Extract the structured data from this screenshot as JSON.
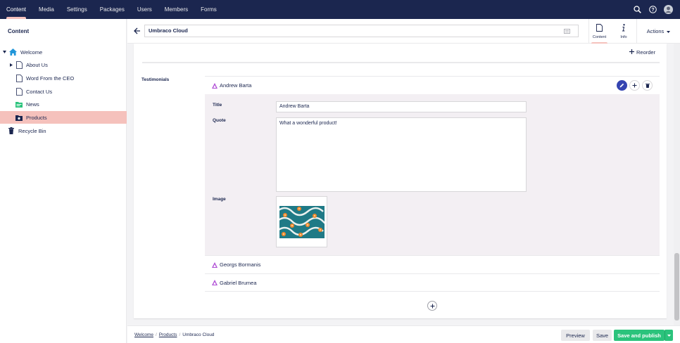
{
  "topnav": {
    "items": [
      "Content",
      "Media",
      "Settings",
      "Packages",
      "Users",
      "Members",
      "Forms"
    ],
    "active_index": 0
  },
  "sidebar": {
    "title": "Content",
    "tree": [
      {
        "label": "Welcome",
        "icon": "home-icon",
        "level": 0,
        "expanded": true
      },
      {
        "label": "About Us",
        "icon": "document-icon",
        "level": 1,
        "expandable": true
      },
      {
        "label": "Word From the CEO",
        "icon": "document-icon",
        "level": 1
      },
      {
        "label": "Contact Us",
        "icon": "document-icon",
        "level": 1
      },
      {
        "label": "News",
        "icon": "news-folder-icon",
        "level": 1
      },
      {
        "label": "Products",
        "icon": "products-folder-icon",
        "level": 1,
        "selected": true
      },
      {
        "label": "Recycle Bin",
        "icon": "trash-icon",
        "level": 0
      }
    ]
  },
  "editor": {
    "node_name": "Umbraco Cloud",
    "apps": [
      {
        "label": "Content",
        "icon": "document-icon",
        "active": true
      },
      {
        "label": "Info",
        "icon": "info-icon",
        "active": false
      }
    ],
    "actions_label": "Actions",
    "reorder_label": "Reorder",
    "property_label": "Testimonials",
    "blocks": [
      {
        "name": "Andrew Barta",
        "expanded": true,
        "fields": {
          "title_label": "Title",
          "title_value": "Andrew Barta",
          "quote_label": "Quote",
          "quote_value": "What a wonderful product!",
          "image_label": "Image"
        }
      },
      {
        "name": "Georgs Bormanis",
        "expanded": false
      },
      {
        "name": "Gabriel Brumea",
        "expanded": false
      }
    ]
  },
  "footer": {
    "breadcrumbs": [
      "Welcome",
      "Products",
      "Umbraco Cloud"
    ],
    "buttons": {
      "preview": "Preview",
      "save": "Save",
      "save_publish": "Save and publish"
    }
  },
  "colors": {
    "nav_bg": "#1b264f",
    "accent": "#f5c1bc",
    "primary_button": "#2bc37c",
    "block_body_bg": "#f3eff3",
    "edit_button": "#3544b1"
  }
}
